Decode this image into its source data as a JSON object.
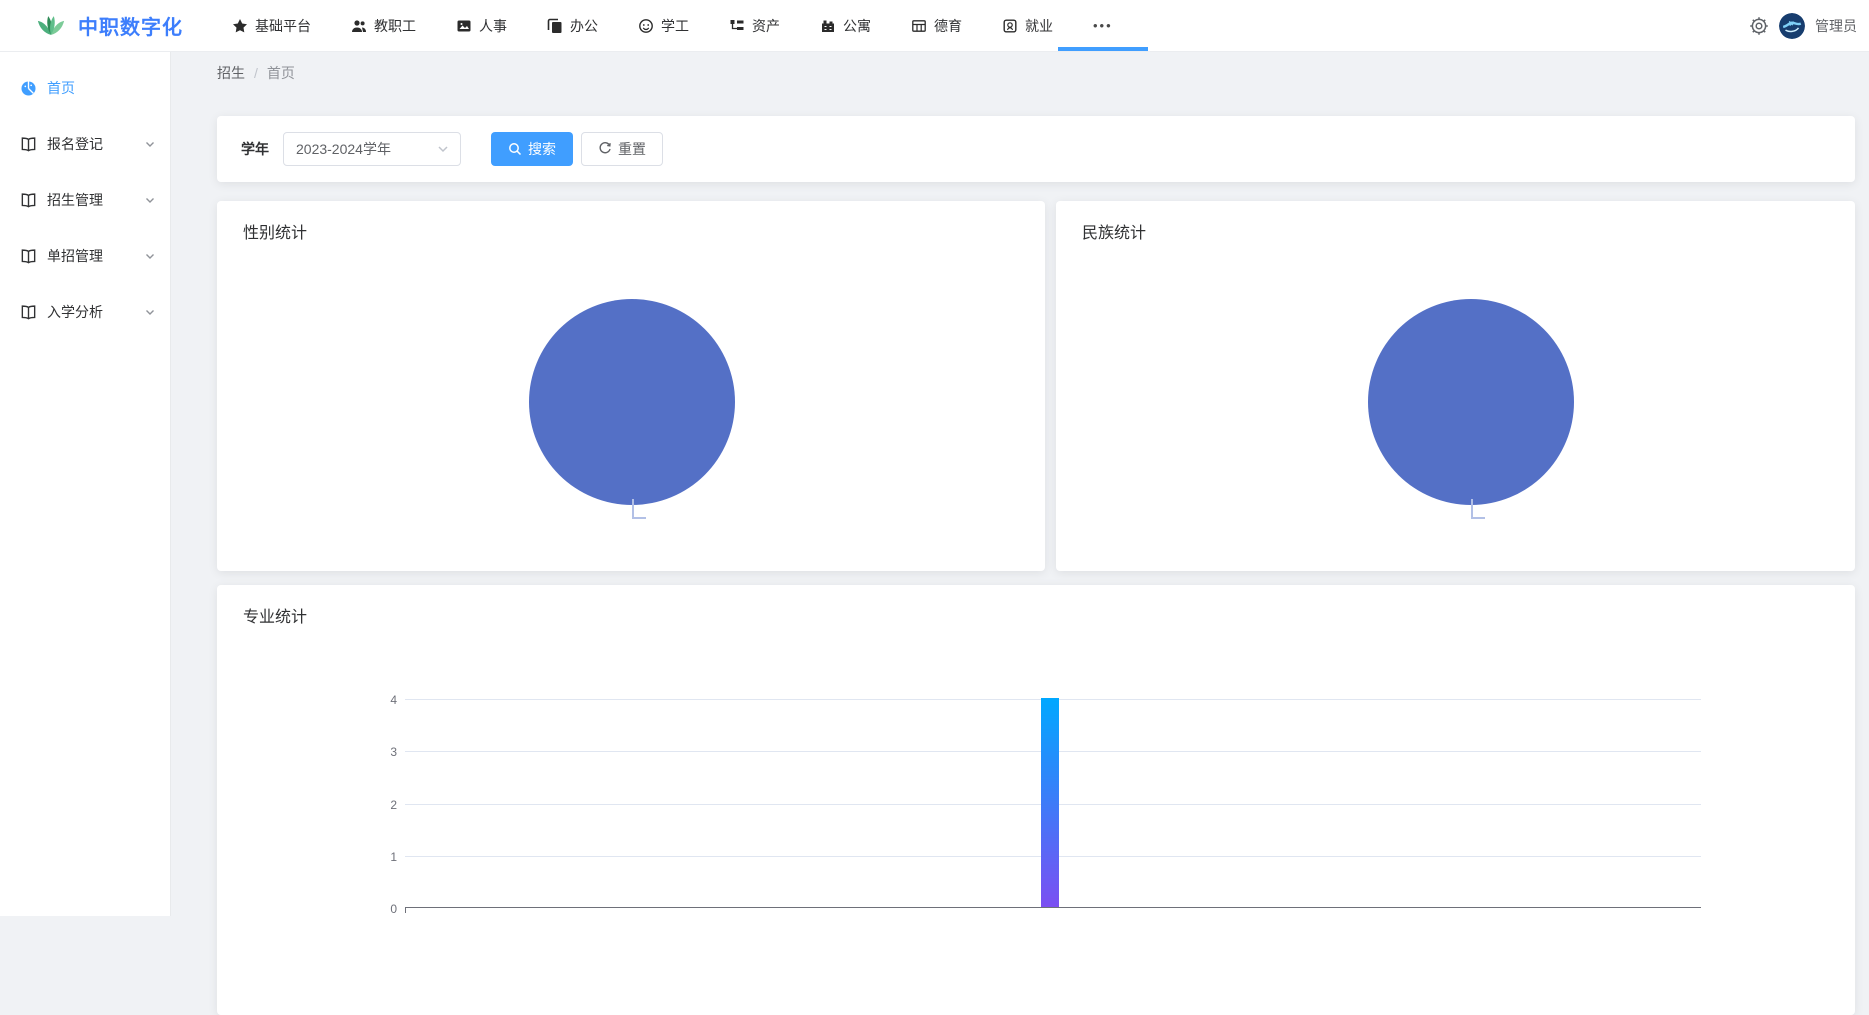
{
  "app": {
    "title": "中职数字化",
    "user": {
      "name": "管理员"
    }
  },
  "topnav": {
    "items": [
      {
        "label": "基础平台",
        "icon": "star-icon"
      },
      {
        "label": "教职工",
        "icon": "users-icon"
      },
      {
        "label": "人事",
        "icon": "photo-card-icon"
      },
      {
        "label": "办公",
        "icon": "copy-docs-icon"
      },
      {
        "label": "学工",
        "icon": "face-icon"
      },
      {
        "label": "资产",
        "icon": "tree-list-icon"
      },
      {
        "label": "公寓",
        "icon": "building-icon"
      },
      {
        "label": "德育",
        "icon": "table-grid-icon"
      },
      {
        "label": "就业",
        "icon": "badge-icon"
      },
      {
        "label": "•••",
        "icon": "more-dots-icon",
        "active": true
      }
    ]
  },
  "sidebar": {
    "items": [
      {
        "label": "首页",
        "icon": "dashboard-icon",
        "active": true,
        "expandable": false
      },
      {
        "label": "报名登记",
        "icon": "book-icon",
        "expandable": true
      },
      {
        "label": "招生管理",
        "icon": "book-icon",
        "expandable": true
      },
      {
        "label": "单招管理",
        "icon": "book-icon",
        "expandable": true
      },
      {
        "label": "入学分析",
        "icon": "book-icon",
        "expandable": true
      }
    ]
  },
  "breadcrumb": {
    "items": [
      "招生",
      "首页"
    ],
    "separator": "/"
  },
  "filter": {
    "year_label": "学年",
    "year_value": "2023-2024学年",
    "search_label": "搜索",
    "reset_label": "重置"
  },
  "cards": {
    "gender": {
      "title": "性别统计"
    },
    "ethnicity": {
      "title": "民族统计"
    },
    "major": {
      "title": "专业统计"
    }
  },
  "chart_data": [
    {
      "id": "gender-pie",
      "type": "pie",
      "title": "性别统计",
      "legend": false,
      "slices": [
        {
          "label": "",
          "fraction": 1.0,
          "color": "#5470C6"
        }
      ]
    },
    {
      "id": "ethnicity-pie",
      "type": "pie",
      "title": "民族统计",
      "legend": false,
      "slices": [
        {
          "label": "",
          "fraction": 1.0,
          "color": "#5470C6"
        }
      ]
    },
    {
      "id": "major-bar",
      "type": "bar",
      "title": "专业统计",
      "xlabel": "",
      "ylabel": "",
      "ylim": [
        0,
        4
      ],
      "yticks": [
        4,
        3,
        2,
        1,
        0
      ],
      "grid": true,
      "x_axis_labels_visible": false,
      "series": [
        {
          "name": "",
          "bars": [
            {
              "category": "",
              "value": 4,
              "x_fraction": 0.498,
              "gradient_top": "#00A8FF",
              "gradient_bottom": "#7B4FF2"
            }
          ]
        }
      ]
    }
  ],
  "colors": {
    "brand_blue": "#3D7EFC",
    "primary": "#409EFF",
    "pie": "#5470C6",
    "pie_leader": "#B2C0E6",
    "bar_gradient_top": "#00A8FF",
    "bar_gradient_bottom": "#7B4FF2",
    "background": "#F0F2F5",
    "axis": "#6E7079",
    "gridline": "#E0E6F1",
    "avatar_navy": "#173D6E"
  }
}
